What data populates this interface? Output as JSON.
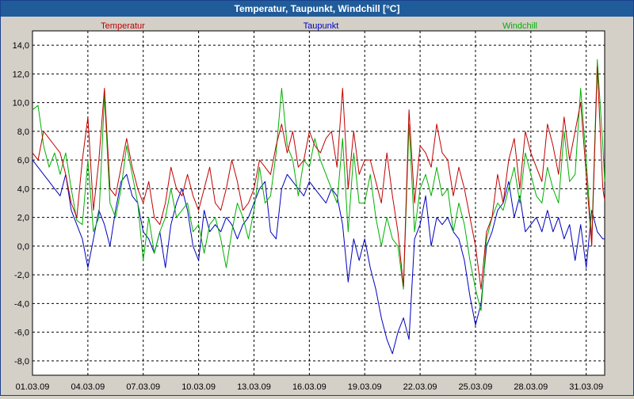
{
  "window": {
    "title": "Temperatur, Taupunkt, Windchill [°C]"
  },
  "chart_data": {
    "type": "line",
    "title": "Temperatur, Taupunkt, Windchill [°C]",
    "ylim": [
      -9,
      15
    ],
    "y_ticks": [
      -8,
      -6,
      -4,
      -2,
      0,
      2,
      4,
      6,
      8,
      10,
      12,
      14
    ],
    "y_tick_labels": [
      "-8,0",
      "-6,0",
      "-4,0",
      "-2,0",
      "0,0",
      "2,0",
      "4,0",
      "6,0",
      "8,0",
      "10,0",
      "12,0",
      "14,0"
    ],
    "x_tick_labels": [
      "01.03.09",
      "04.03.09",
      "07.03.09",
      "10.03.09",
      "13.03.09",
      "16.03.09",
      "19.03.09",
      "22.03.09",
      "25.03.09",
      "28.03.09",
      "31.03.09"
    ],
    "x_tick_days": [
      1,
      4,
      7,
      10,
      13,
      16,
      19,
      22,
      25,
      28,
      31
    ],
    "xlim_days": [
      1,
      32
    ],
    "grid": true,
    "legend_position": "top",
    "series": [
      {
        "name": "Temperatur",
        "color": "#c00000",
        "x_days": [
          1.0,
          1.3,
          1.6,
          1.9,
          2.2,
          2.5,
          2.8,
          3.1,
          3.4,
          3.7,
          4.0,
          4.3,
          4.6,
          4.9,
          5.2,
          5.5,
          5.8,
          6.1,
          6.4,
          6.7,
          7.0,
          7.3,
          7.6,
          7.9,
          8.2,
          8.5,
          8.8,
          9.1,
          9.4,
          9.7,
          10.0,
          10.3,
          10.6,
          10.9,
          11.2,
          11.5,
          11.8,
          12.1,
          12.4,
          12.7,
          13.0,
          13.3,
          13.6,
          13.9,
          14.2,
          14.5,
          14.8,
          15.1,
          15.4,
          15.7,
          16.0,
          16.3,
          16.6,
          16.9,
          17.2,
          17.5,
          17.8,
          18.1,
          18.4,
          18.7,
          19.0,
          19.3,
          19.6,
          19.9,
          20.2,
          20.5,
          20.8,
          21.1,
          21.4,
          21.7,
          22.0,
          22.3,
          22.6,
          22.9,
          23.2,
          23.5,
          23.8,
          24.1,
          24.4,
          24.7,
          25.0,
          25.3,
          25.6,
          25.9,
          26.2,
          26.5,
          26.8,
          27.1,
          27.4,
          27.7,
          28.0,
          28.3,
          28.6,
          28.9,
          29.2,
          29.5,
          29.8,
          30.1,
          30.4,
          30.7,
          31.0,
          31.3,
          31.6,
          31.9,
          32.0
        ],
        "values": [
          6.5,
          6.0,
          8.0,
          7.5,
          7.0,
          6.5,
          5.0,
          3.0,
          2.0,
          6.0,
          9.0,
          2.5,
          6.0,
          11.0,
          4.0,
          3.5,
          5.5,
          7.5,
          5.5,
          4.0,
          3.0,
          4.5,
          2.0,
          1.5,
          3.0,
          5.5,
          4.0,
          3.5,
          5.0,
          3.5,
          2.5,
          4.0,
          5.5,
          3.0,
          2.5,
          4.0,
          6.0,
          4.5,
          2.5,
          3.0,
          4.0,
          6.0,
          5.5,
          5.0,
          7.0,
          8.5,
          6.5,
          8.0,
          5.5,
          6.0,
          8.0,
          7.0,
          6.5,
          7.5,
          8.0,
          5.5,
          11.0,
          4.0,
          8.0,
          5.0,
          6.0,
          6.0,
          4.5,
          3.0,
          6.5,
          3.5,
          1.0,
          -2.8,
          9.5,
          3.0,
          7.0,
          6.5,
          5.5,
          8.5,
          6.5,
          6.0,
          3.5,
          5.5,
          4.0,
          2.0,
          0.0,
          -3.0,
          1.0,
          2.0,
          5.0,
          3.0,
          6.0,
          7.5,
          4.0,
          8.0,
          6.5,
          5.5,
          4.5,
          8.5,
          7.0,
          5.0,
          9.0,
          6.0,
          8.0,
          10.0,
          5.0,
          0.0,
          12.5,
          4.0,
          3.2
        ]
      },
      {
        "name": "Taupunkt",
        "color": "#0000c0",
        "x_days": [
          1.0,
          1.3,
          1.6,
          1.9,
          2.2,
          2.5,
          2.8,
          3.1,
          3.4,
          3.7,
          4.0,
          4.3,
          4.6,
          4.9,
          5.2,
          5.5,
          5.8,
          6.1,
          6.4,
          6.7,
          7.0,
          7.3,
          7.6,
          7.9,
          8.2,
          8.5,
          8.8,
          9.1,
          9.4,
          9.7,
          10.0,
          10.3,
          10.6,
          10.9,
          11.2,
          11.5,
          11.8,
          12.1,
          12.4,
          12.7,
          13.0,
          13.3,
          13.6,
          13.9,
          14.2,
          14.5,
          14.8,
          15.1,
          15.4,
          15.7,
          16.0,
          16.3,
          16.6,
          16.9,
          17.2,
          17.5,
          17.8,
          18.1,
          18.4,
          18.7,
          19.0,
          19.3,
          19.6,
          19.9,
          20.2,
          20.5,
          20.8,
          21.1,
          21.4,
          21.7,
          22.0,
          22.3,
          22.6,
          22.9,
          23.2,
          23.5,
          23.8,
          24.1,
          24.4,
          24.7,
          25.0,
          25.3,
          25.6,
          25.9,
          26.2,
          26.5,
          26.8,
          27.1,
          27.4,
          27.7,
          28.0,
          28.3,
          28.6,
          28.9,
          29.2,
          29.5,
          29.8,
          30.1,
          30.4,
          30.7,
          31.0,
          31.3,
          31.6,
          31.9,
          32.0
        ],
        "values": [
          6.0,
          5.5,
          5.0,
          4.5,
          4.0,
          3.5,
          5.0,
          2.5,
          1.5,
          0.5,
          -1.5,
          0.5,
          2.5,
          1.5,
          0.0,
          2.5,
          4.5,
          5.0,
          3.5,
          3.0,
          1.0,
          0.5,
          -0.5,
          1.0,
          -1.5,
          1.5,
          3.0,
          4.0,
          2.5,
          0.0,
          -1.0,
          2.5,
          1.0,
          1.5,
          1.0,
          2.0,
          1.5,
          0.5,
          1.5,
          2.0,
          3.0,
          4.0,
          4.5,
          1.0,
          0.5,
          4.0,
          5.0,
          4.5,
          4.0,
          3.5,
          4.5,
          4.0,
          3.5,
          3.0,
          4.0,
          3.5,
          1.5,
          -2.5,
          0.5,
          -1.0,
          0.5,
          -1.5,
          -3.0,
          -5.0,
          -6.5,
          -7.5,
          -6.0,
          -5.0,
          -6.5,
          0.5,
          1.5,
          3.5,
          0.0,
          2.0,
          1.5,
          2.0,
          1.0,
          0.5,
          -1.0,
          -3.5,
          -5.5,
          -4.0,
          0.0,
          1.0,
          2.5,
          3.0,
          4.5,
          2.0,
          3.5,
          1.0,
          1.5,
          2.0,
          1.0,
          2.5,
          1.0,
          2.0,
          0.5,
          1.5,
          -1.0,
          1.5,
          -1.5,
          2.5,
          1.0,
          0.5,
          0.5
        ]
      },
      {
        "name": "Windchill",
        "color": "#00b000",
        "x_days": [
          1.0,
          1.3,
          1.6,
          1.9,
          2.2,
          2.5,
          2.8,
          3.1,
          3.4,
          3.7,
          4.0,
          4.3,
          4.6,
          4.9,
          5.2,
          5.5,
          5.8,
          6.1,
          6.4,
          6.7,
          7.0,
          7.3,
          7.6,
          7.9,
          8.2,
          8.5,
          8.8,
          9.1,
          9.4,
          9.7,
          10.0,
          10.3,
          10.6,
          10.9,
          11.2,
          11.5,
          11.8,
          12.1,
          12.4,
          12.7,
          13.0,
          13.3,
          13.6,
          13.9,
          14.2,
          14.5,
          14.8,
          15.1,
          15.4,
          15.7,
          16.0,
          16.3,
          16.6,
          16.9,
          17.2,
          17.5,
          17.8,
          18.1,
          18.4,
          18.7,
          19.0,
          19.3,
          19.6,
          19.9,
          20.2,
          20.5,
          20.8,
          21.1,
          21.4,
          21.7,
          22.0,
          22.3,
          22.6,
          22.9,
          23.2,
          23.5,
          23.8,
          24.1,
          24.4,
          24.7,
          25.0,
          25.3,
          25.6,
          25.9,
          26.2,
          26.5,
          26.8,
          27.1,
          27.4,
          27.7,
          28.0,
          28.3,
          28.6,
          28.9,
          29.2,
          29.5,
          29.8,
          30.1,
          30.4,
          30.7,
          31.0,
          31.3,
          31.6,
          31.9,
          32.0
        ],
        "values": [
          9.5,
          9.8,
          7.0,
          5.5,
          6.5,
          5.0,
          6.5,
          4.0,
          1.8,
          1.5,
          6.0,
          1.0,
          2.0,
          10.5,
          3.0,
          2.0,
          4.0,
          7.0,
          5.0,
          3.0,
          -1.0,
          2.0,
          -0.5,
          1.0,
          2.0,
          4.0,
          2.0,
          2.5,
          3.0,
          1.0,
          1.5,
          -0.5,
          1.5,
          2.0,
          0.5,
          -1.5,
          1.0,
          3.0,
          2.0,
          0.5,
          2.5,
          5.5,
          3.0,
          3.5,
          6.5,
          11.0,
          7.0,
          6.0,
          3.5,
          6.0,
          5.5,
          7.5,
          6.0,
          5.0,
          4.0,
          3.0,
          7.5,
          1.0,
          6.5,
          3.0,
          3.0,
          5.0,
          2.0,
          0.0,
          2.0,
          0.5,
          0.0,
          -3.0,
          8.5,
          1.0,
          4.0,
          5.0,
          3.5,
          5.5,
          3.5,
          4.0,
          1.0,
          3.0,
          1.5,
          -1.0,
          -3.0,
          -4.5,
          0.5,
          2.0,
          3.0,
          2.5,
          4.0,
          5.5,
          3.0,
          6.5,
          5.0,
          3.5,
          3.0,
          5.5,
          4.0,
          3.0,
          8.0,
          4.5,
          5.0,
          11.0,
          6.0,
          0.5,
          13.0,
          7.0,
          4.5
        ]
      }
    ]
  }
}
